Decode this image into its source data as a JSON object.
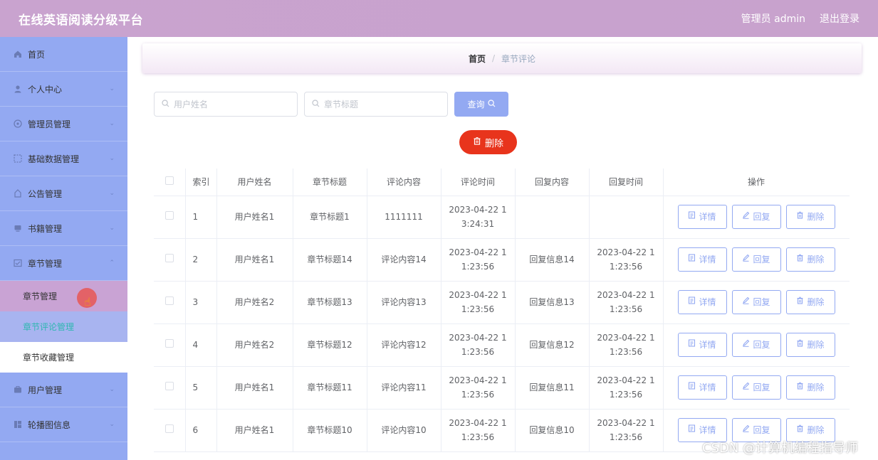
{
  "header": {
    "brand": "在线英语阅读分级平台",
    "user": "管理员 admin",
    "logout": "退出登录"
  },
  "sidebar": {
    "items": [
      {
        "label": "首页",
        "icon": "home-icon",
        "expandable": false
      },
      {
        "label": "个人中心",
        "icon": "user-icon",
        "expandable": true
      },
      {
        "label": "管理员管理",
        "icon": "admin-icon",
        "expandable": true
      },
      {
        "label": "基础数据管理",
        "icon": "data-icon",
        "expandable": true
      },
      {
        "label": "公告管理",
        "icon": "notice-icon",
        "expandable": true
      },
      {
        "label": "书籍管理",
        "icon": "book-icon",
        "expandable": true
      },
      {
        "label": "章节管理",
        "icon": "chapter-icon",
        "expandable": true
      }
    ],
    "submenu": [
      {
        "label": "章节管理"
      },
      {
        "label": "章节评论管理"
      },
      {
        "label": "章节收藏管理"
      }
    ],
    "items_after": [
      {
        "label": "用户管理",
        "icon": "users-icon",
        "expandable": true
      },
      {
        "label": "轮播图信息",
        "icon": "carousel-icon",
        "expandable": true
      }
    ]
  },
  "breadcrumb": {
    "home": "首页",
    "separator": "/",
    "current": "章节评论"
  },
  "search": {
    "username_placeholder": "用户姓名",
    "chapter_placeholder": "章节标题",
    "query_label": "查询"
  },
  "actions": {
    "delete_label": "删除"
  },
  "table": {
    "headers": [
      "索引",
      "用户姓名",
      "章节标题",
      "评论内容",
      "评论时间",
      "回复内容",
      "回复时间",
      "操作"
    ],
    "rows": [
      {
        "index": "1",
        "user": "用户姓名1",
        "chapter": "章节标题1",
        "comment": "1111111",
        "comment_time_1": "2023-04-22 1",
        "comment_time_2": "3:24:31",
        "reply": "",
        "reply_time_1": "",
        "reply_time_2": ""
      },
      {
        "index": "2",
        "user": "用户姓名1",
        "chapter": "章节标题14",
        "comment": "评论内容14",
        "comment_time_1": "2023-04-22 1",
        "comment_time_2": "1:23:56",
        "reply": "回复信息14",
        "reply_time_1": "2023-04-22 1",
        "reply_time_2": "1:23:56"
      },
      {
        "index": "3",
        "user": "用户姓名2",
        "chapter": "章节标题13",
        "comment": "评论内容13",
        "comment_time_1": "2023-04-22 1",
        "comment_time_2": "1:23:56",
        "reply": "回复信息13",
        "reply_time_1": "2023-04-22 1",
        "reply_time_2": "1:23:56"
      },
      {
        "index": "4",
        "user": "用户姓名2",
        "chapter": "章节标题12",
        "comment": "评论内容12",
        "comment_time_1": "2023-04-22 1",
        "comment_time_2": "1:23:56",
        "reply": "回复信息12",
        "reply_time_1": "2023-04-22 1",
        "reply_time_2": "1:23:56"
      },
      {
        "index": "5",
        "user": "用户姓名1",
        "chapter": "章节标题11",
        "comment": "评论内容11",
        "comment_time_1": "2023-04-22 1",
        "comment_time_2": "1:23:56",
        "reply": "回复信息11",
        "reply_time_1": "2023-04-22 1",
        "reply_time_2": "1:23:56"
      },
      {
        "index": "6",
        "user": "用户姓名1",
        "chapter": "章节标题10",
        "comment": "评论内容10",
        "comment_time_1": "2023-04-22 1",
        "comment_time_2": "1:23:56",
        "reply": "回复信息10",
        "reply_time_1": "2023-04-22 1",
        "reply_time_2": "1:23:56"
      }
    ],
    "row_actions": {
      "detail": "详情",
      "reply": "回复",
      "delete": "删除"
    }
  },
  "watermark": "CSDN @计算机编程指导师",
  "colors": {
    "header_bg": "#c8a2cd",
    "sidebar_bg": "#93a9f2",
    "accent": "#93a9f2",
    "danger": "#e8341c",
    "active_sub_text": "#2fb7b1"
  }
}
